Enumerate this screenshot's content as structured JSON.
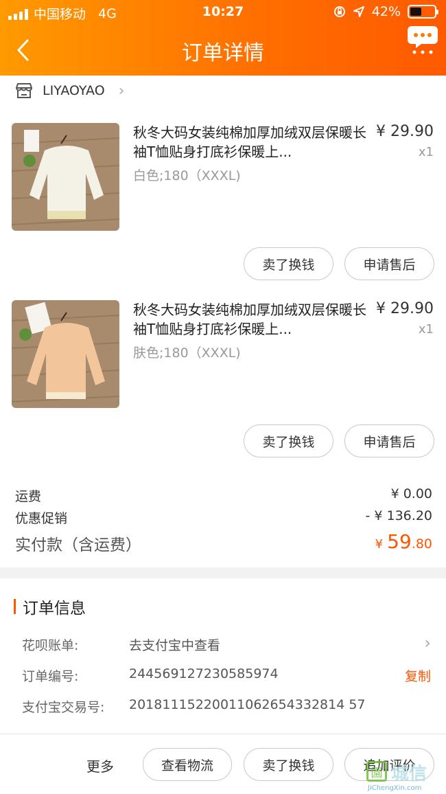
{
  "status_bar": {
    "carrier": "中国移动",
    "network": "4G",
    "time": "10:27",
    "battery": "42%"
  },
  "header": {
    "title": "订单详情",
    "back_icon": "chevron-left-icon",
    "more_icon": "chat-bubble-more-icon",
    "accent_color": "#ff6d00"
  },
  "shop": {
    "name": "LIYAOYAO",
    "icon": "store-icon"
  },
  "products": [
    {
      "title": "秋冬大码女装纯棉加厚加绒双层保暖长袖T恤贴身打底衫保暖上...",
      "sku": "白色;180（XXXL)",
      "price": "¥ 29.90",
      "qty": "x1",
      "color": "#f4f1e6",
      "actions": [
        "卖了换钱",
        "申请售后"
      ]
    },
    {
      "title": "秋冬大码女装纯棉加厚加绒双层保暖长袖T恤贴身打底衫保暖上...",
      "sku": "肤色;180（XXXL)",
      "price": "¥ 29.90",
      "qty": "x1",
      "color": "#f2c69a",
      "actions": [
        "卖了换钱",
        "申请售后"
      ]
    }
  ],
  "fees": {
    "shipping_label": "运费",
    "shipping_value": "¥ 0.00",
    "discount_label": "优惠促销",
    "discount_value": "- ¥ 136.20",
    "total_label": "实付款（含运费）",
    "total_currency": "¥",
    "total_int": "59",
    "total_dec": ".80",
    "total_color": "#ff5500"
  },
  "order_info": {
    "heading": "订单信息",
    "rows": [
      {
        "label": "花呗账单:",
        "value": "去支付宝中查看",
        "action": "›"
      },
      {
        "label": "订单编号:",
        "value": "244569127230585974",
        "action": "复制"
      },
      {
        "label": "支付宝交易号:",
        "value": "20181115220011062654332814 57"
      }
    ]
  },
  "bottom_bar": {
    "more": "更多",
    "buttons": [
      "查看物流",
      "卖了换钱",
      "追加评价"
    ]
  },
  "watermark": {
    "text": "城信",
    "sub": "JiChengXin.com"
  }
}
